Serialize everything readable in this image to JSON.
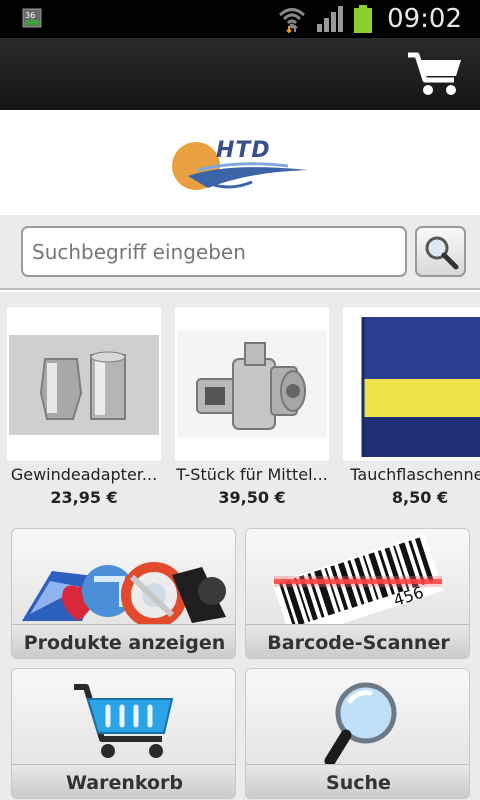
{
  "status_bar": {
    "time": "09:02",
    "icons": [
      "notification-icon",
      "wifi-icon",
      "signal-icon",
      "battery-icon"
    ]
  },
  "action_bar": {
    "icons": [
      "shopping-cart-icon"
    ]
  },
  "logo": {
    "text": "HTD"
  },
  "search": {
    "placeholder": "Suchbegriff eingeben",
    "value": "",
    "button_icon": "magnifier-icon"
  },
  "products": [
    {
      "name": "Gewindeadapter...",
      "price": "23,95 €"
    },
    {
      "name": "T-Stück für Mittel...",
      "price": "39,50 €"
    },
    {
      "name": "Tauchflaschennet",
      "price": "8,50 €"
    }
  ],
  "tiles": [
    {
      "label": "Produkte anzeigen",
      "icon": "apps-collage-icon"
    },
    {
      "label": "Barcode-Scanner",
      "icon": "barcode-icon"
    },
    {
      "label": "Warenkorb",
      "icon": "shopping-cart-icon"
    },
    {
      "label": "Suche",
      "icon": "magnifier-icon"
    }
  ],
  "colors": {
    "status_bar_bg": "#000000",
    "action_bar_bg": "#1e1e1e",
    "battery": "#8bd12e",
    "background": "#ebebeb"
  }
}
